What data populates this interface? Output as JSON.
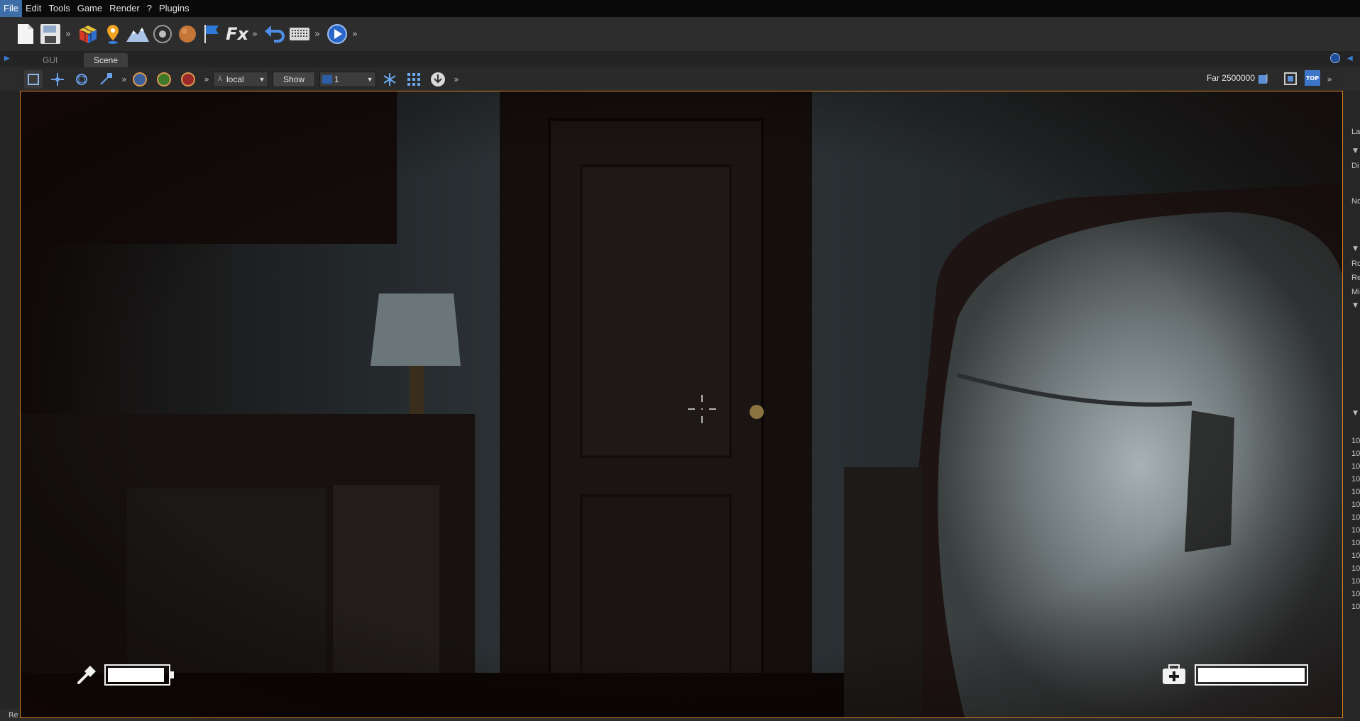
{
  "menu": {
    "items": [
      {
        "label": "File",
        "active": true
      },
      {
        "label": "Edit"
      },
      {
        "label": "Tools"
      },
      {
        "label": "Game"
      },
      {
        "label": "Render"
      },
      {
        "label": "?"
      },
      {
        "label": "Plugins"
      }
    ]
  },
  "toolbar": {
    "icons": [
      "new-file-icon",
      "save-icon",
      "rubiks-cube-icon",
      "map-pin-icon",
      "terrain-icon",
      "tire-icon",
      "sphere-texture-icon",
      "flag-icon",
      "fx-icon",
      "undo-icon",
      "keyboard-icon",
      "play-icon"
    ],
    "fx_label": "Fx",
    "more": "»"
  },
  "tabs": [
    {
      "label": "GUI",
      "active": false
    },
    {
      "label": "Scene",
      "active": true
    }
  ],
  "scene_toolbar": {
    "space_dropdown": "local",
    "show_button": "Show",
    "count_dropdown": "1",
    "far_label": "Far 2500000",
    "top_badge": "TOP",
    "more": "»"
  },
  "hud": {
    "battery_level": 0.95,
    "health_level": 1.0
  },
  "right_panel": {
    "labels": [
      "La",
      "Di",
      "No",
      "Ro",
      "Re",
      "Mi"
    ],
    "numbers": [
      "10",
      "10",
      "10",
      "10",
      "10",
      "10",
      "10",
      "10",
      "10",
      "10",
      "10",
      "10",
      "10",
      "10"
    ]
  },
  "status_bar": {
    "text": "Re"
  },
  "colors": {
    "accent": "#3d6ea8",
    "viewport_border": "#d6821f",
    "hud_white": "#ffffff"
  }
}
